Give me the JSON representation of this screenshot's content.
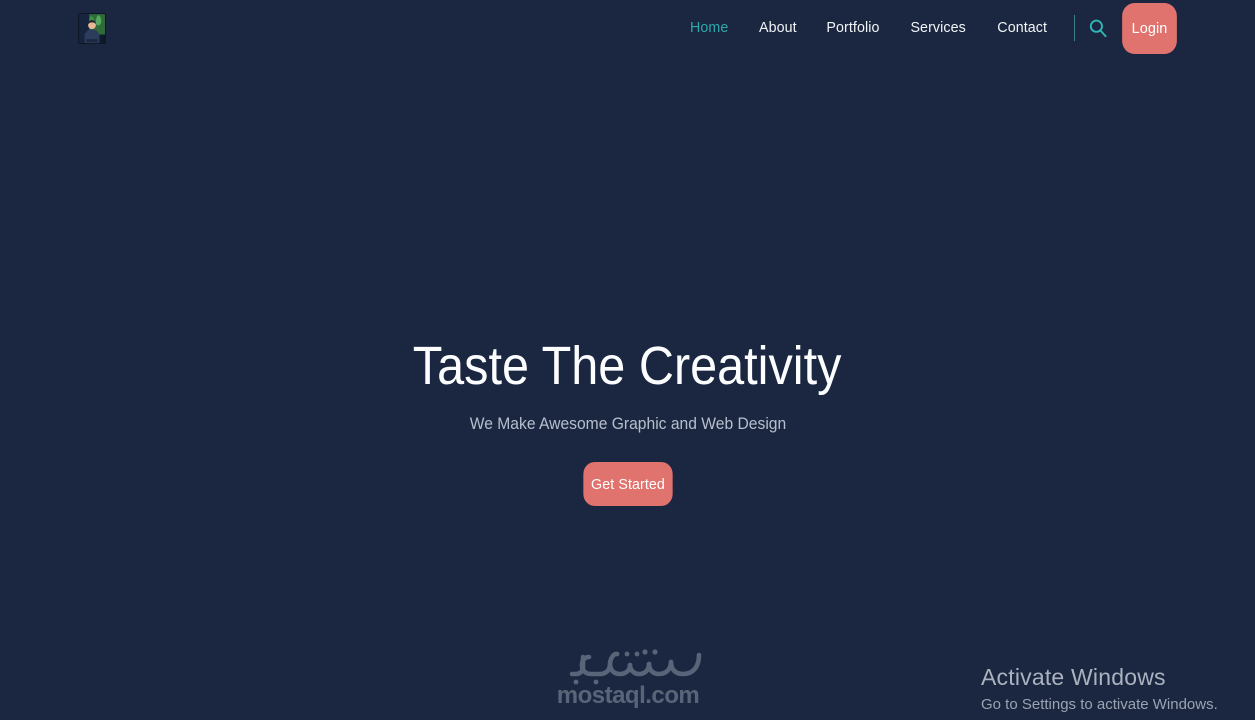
{
  "colors": {
    "background": "#1b2740",
    "accent_teal": "#2fa8ab",
    "accent_coral": "#e0736e",
    "heading": "#fbfdff",
    "subtitle": "#b6bfcd",
    "nav_text": "#f2f5f8",
    "divider": "#3d7f86"
  },
  "header": {
    "logo": {
      "name": "site-logo",
      "alt": "Profile photo logo"
    },
    "nav": [
      {
        "label": "Home",
        "active": true
      },
      {
        "label": "About",
        "active": false
      },
      {
        "label": "Portfolio",
        "active": false
      },
      {
        "label": "Services",
        "active": false
      },
      {
        "label": "Contact",
        "active": false
      }
    ],
    "search_icon": "search-icon",
    "login_label": "Login"
  },
  "hero": {
    "title": "Taste The Creativity",
    "subtitle": "We Make Awesome Graphic and Web Design",
    "cta_label": "Get Started"
  },
  "watermark": {
    "arabic": "مستقل",
    "latin": "mostaql.com"
  },
  "windows_activation": {
    "title": "Activate Windows",
    "subtitle": "Go to Settings to activate Windows."
  }
}
